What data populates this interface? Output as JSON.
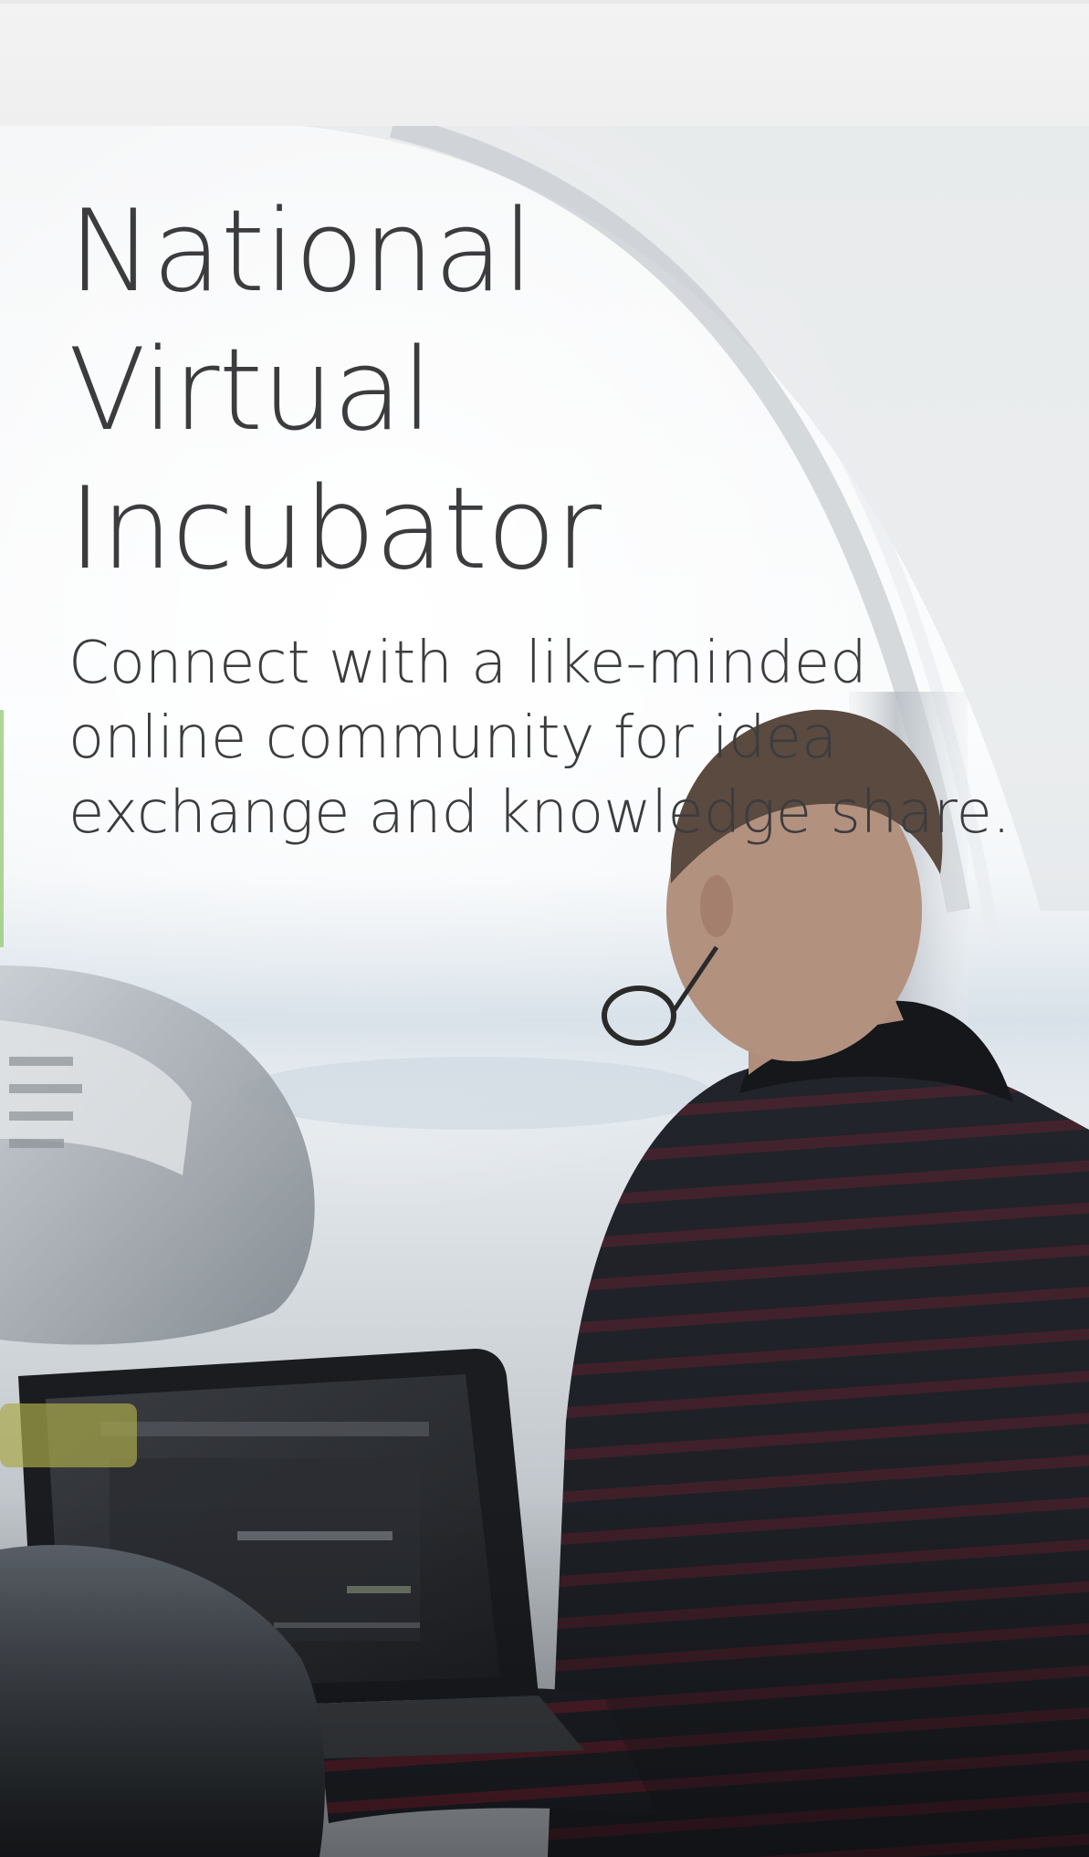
{
  "hero": {
    "title": "National Virtual Incubator",
    "subtitle": "Connect with a like-minded online community for idea exchange and knowledge share."
  },
  "colors": {
    "text": "#3c3c3e",
    "header_bar": "#f1f1f1",
    "sweater_dark": "#1f2228",
    "sweater_stripe": "#6e2330"
  }
}
